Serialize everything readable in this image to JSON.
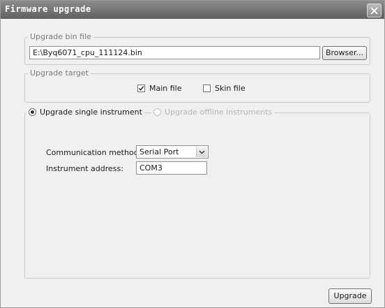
{
  "window": {
    "title": "Firmware upgrade",
    "close_icon": "close-icon"
  },
  "bin_file": {
    "legend": "Upgrade bin file",
    "path_value": "E:\\Byq6071_cpu_111124.bin",
    "browse_label": "Browser..."
  },
  "target": {
    "legend": "Upgrade target",
    "main_file": {
      "label": "Main file",
      "checked": true
    },
    "skin_file": {
      "label": "Skin file",
      "checked": false
    }
  },
  "mode": {
    "single_label": "Upgrade single instrument",
    "offline_label": "Upgrade offline instruments",
    "selected": "single"
  },
  "settings": {
    "comm_label": "Communication method:",
    "comm_value": "Serial Port",
    "address_label": "Instrument address:",
    "address_value": "COM3"
  },
  "footer": {
    "upgrade_label": "Upgrade"
  },
  "colors": {
    "titlebar": "#6f6f6f",
    "background": "#f0f0f0",
    "disabled_text": "#b5b5b5"
  }
}
